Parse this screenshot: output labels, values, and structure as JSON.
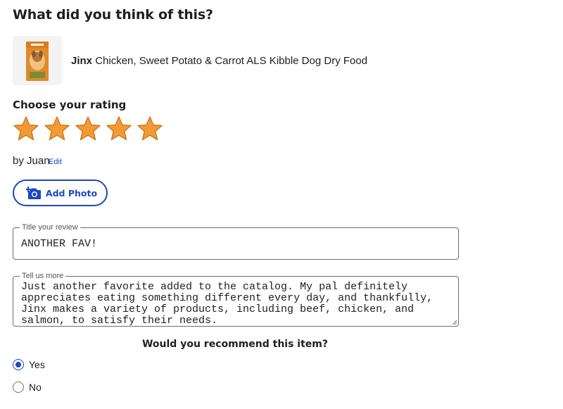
{
  "page": {
    "heading": "What did you think of this?"
  },
  "product": {
    "brand": "Jinx",
    "name": "Chicken, Sweet Potato & Carrot ALS Kibble Dog Dry Food",
    "thumbnail_icon": "dog-food-bag-image"
  },
  "rating": {
    "heading": "Choose your rating",
    "value": 5,
    "max": 5,
    "star_color": "#f29a34",
    "star_stroke": "#c9741b"
  },
  "author": {
    "text": "by Juan",
    "edit_label": "Edit"
  },
  "add_photo": {
    "label": "Add Photo",
    "icon": "camera-plus-icon"
  },
  "review_title": {
    "legend": "Title your review",
    "value": "ANOTHER FAV!"
  },
  "review_body": {
    "legend": "Tell us more",
    "value": "Just another favorite added to the catalog. My pal definitely appreciates eating something different every day, and thankfully, Jinx makes a variety of products, including beef, chicken, and salmon, to satisfy their needs."
  },
  "recommend": {
    "question": "Would you recommend this item?",
    "options": [
      {
        "label": "Yes",
        "selected": true
      },
      {
        "label": "No",
        "selected": false
      }
    ]
  },
  "colors": {
    "accent": "#1c49c2",
    "text": "#1e1e1e"
  }
}
